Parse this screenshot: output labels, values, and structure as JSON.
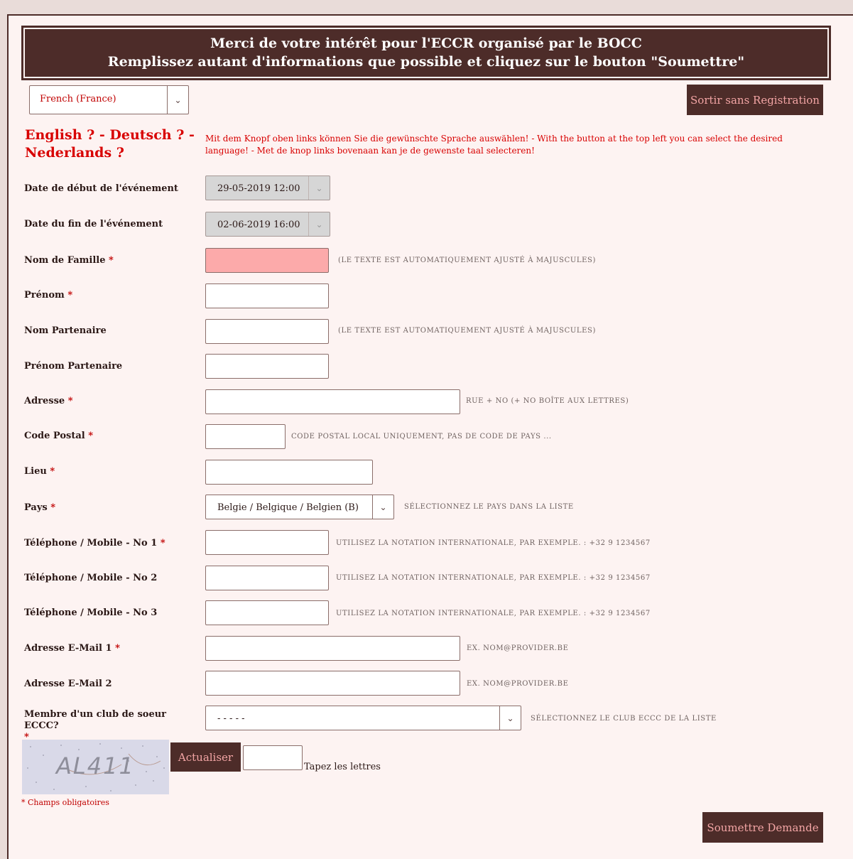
{
  "header": {
    "line1": "Merci de votre intérêt pour l'ECCR organisé par le BOCC",
    "line2": "Remplissez autant d'informations que possible et cliquez sur le bouton \"Soumettre\""
  },
  "language_select": {
    "value": "French (France)"
  },
  "exit_button": "Sortir sans Registration",
  "language_title": "English ? - Deutsch ? - Nederlands ?",
  "language_note": "Mit dem Knopf oben links können Sie die gewünschte Sprache auswählen! - With the button at the top left you can select the desired language! - Met de knop links bovenaan kan je de gewenste taal selecteren!",
  "fields": {
    "start_date": {
      "label": "Date de début de l'événement",
      "value": "29-05-2019 12:00"
    },
    "end_date": {
      "label": "Date du fin de l'événement",
      "value": "02-06-2019 16:00"
    },
    "last_name": {
      "label": "Nom de Famille",
      "required": "*",
      "hint": "(Le texte est automatiquement ajusté à majuscules)"
    },
    "first_name": {
      "label": "Prénom",
      "required": "*"
    },
    "partner_name": {
      "label": "Nom Partenaire",
      "hint": "(Le texte est automatiquement ajusté à majuscules)"
    },
    "partner_first_name": {
      "label": "Prénom Partenaire"
    },
    "address": {
      "label": "Adresse",
      "required": "*",
      "hint": "Rue + No (+ No boîte aux lettres)"
    },
    "postal_code": {
      "label": "Code Postal",
      "required": "*",
      "hint": "Code postal local uniquement, pas de code de pays ..."
    },
    "city": {
      "label": "Lieu",
      "required": "*"
    },
    "country": {
      "label": "Pays",
      "required": "*",
      "value": "Belgie / Belgique / Belgien (B)",
      "hint": "Sélectionnez le pays dans la liste"
    },
    "phone1": {
      "label": "Téléphone / Mobile - No 1",
      "required": "*",
      "hint": "Utilisez la notation internationale, par exemple. : +32 9 1234567"
    },
    "phone2": {
      "label": "Téléphone / Mobile - No 2",
      "hint": "Utilisez la notation internationale, par exemple. : +32 9 1234567"
    },
    "phone3": {
      "label": "Téléphone / Mobile - No 3",
      "hint": "Utilisez la notation internationale, par exemple. : +32 9 1234567"
    },
    "email1": {
      "label": "Adresse E-Mail 1",
      "required": "*",
      "hint": "Ex. nom@provider.be"
    },
    "email2": {
      "label": "Adresse E-Mail 2",
      "hint": "Ex. nom@provider.be"
    },
    "club": {
      "label": "Membre d'un club de soeur ECCC?",
      "required": "*",
      "value": "- - - - -",
      "hint": "Sélectionnez le club ECCC de la liste"
    }
  },
  "captcha": {
    "image_text": "AL411",
    "refresh_button": "Actualiser",
    "label": "Tapez les lettres"
  },
  "mandatory_note": "* Champs obligatoires",
  "submit_button": "Soumettre Demande",
  "colors": {
    "brand": "#4d2c29",
    "background": "#fdf3f2",
    "required": "#c00000",
    "error_field": "#fcaaaa"
  }
}
